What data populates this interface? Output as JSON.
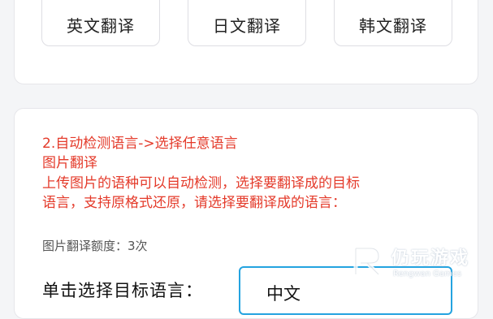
{
  "tiles": [
    {
      "label": "英文翻译",
      "icon": "uk-flag-icon"
    },
    {
      "label": "日文翻译",
      "icon": "japan-flag-icon"
    },
    {
      "label": "韩文翻译",
      "icon": "korea-flag-icon"
    }
  ],
  "info": {
    "line1": "2.自动检测语言->选择任意语言",
    "line2": "图片翻译",
    "line3": "上传图片的语种可以自动检测，选择要翻译成的目标",
    "line4": "语言，支持原格式还原，请选择要翻译成的语言："
  },
  "quota": "图片翻译额度：3次",
  "target": {
    "label": "单击选择目标语言：",
    "value": "中文"
  },
  "watermark": {
    "cn": "仍玩游戏",
    "en": "Rengwan Games"
  },
  "colors": {
    "accent_red": "#e43a2a",
    "select_border": "#24a3e0"
  }
}
